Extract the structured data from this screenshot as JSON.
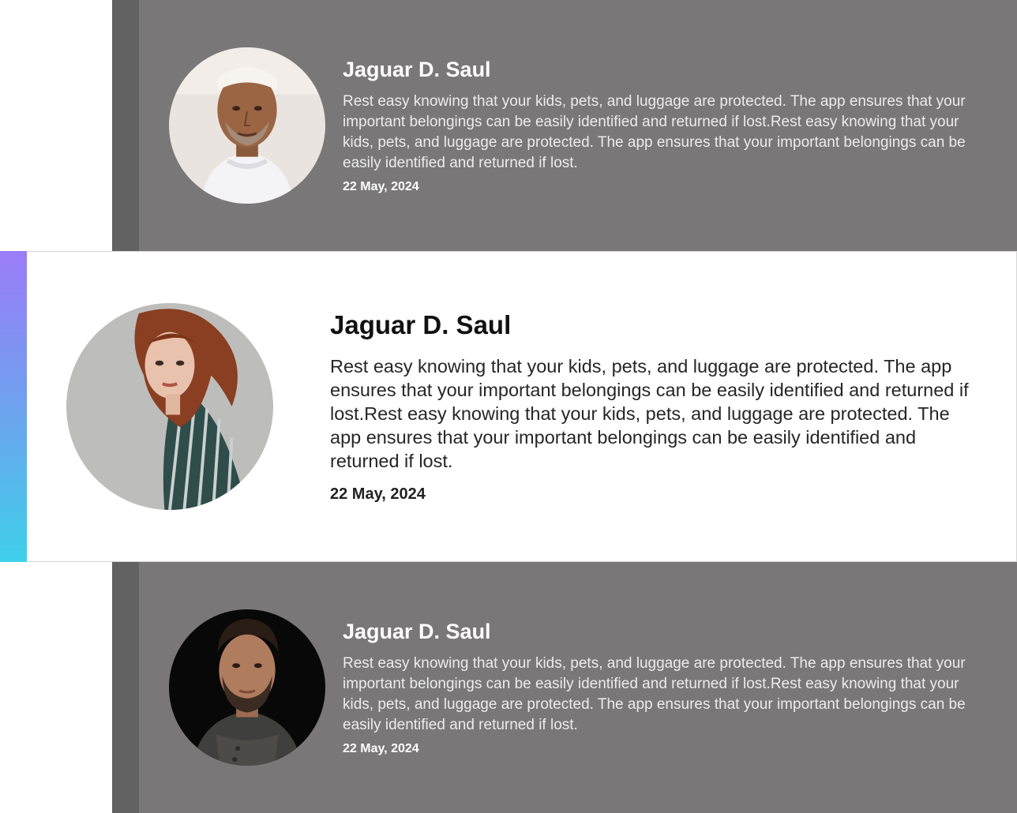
{
  "testimonials": [
    {
      "name": "Jaguar D. Saul",
      "text": "Rest easy knowing that your kids, pets, and luggage are protected. The app ensures that your important belongings can be easily identified and returned if lost.Rest easy knowing that your kids, pets, and luggage are protected. The app ensures that your important belongings can be easily identified and returned if lost.",
      "date": "22 May, 2024",
      "state": "inactive"
    },
    {
      "name": "Jaguar D. Saul",
      "text": "Rest easy knowing that your kids, pets, and luggage are protected. The app ensures that your important belongings can be easily identified and returned if lost.Rest easy knowing that your kids, pets, and luggage are protected. The app ensures that your important belongings can be easily identified and returned if lost.",
      "date": "22 May, 2024",
      "state": "active"
    },
    {
      "name": "Jaguar D. Saul",
      "text": "Rest easy knowing that your kids, pets, and luggage are protected. The app ensures that your important belongings can be easily identified and returned if lost.Rest easy knowing that your kids, pets, and luggage are protected. The app ensures that your important belongings can be easily identified and returned if lost.",
      "date": "22 May, 2024",
      "state": "inactive"
    }
  ],
  "colors": {
    "inactive_card_bg": "#797778",
    "inactive_accent": "#636262",
    "active_accent_gradient": [
      "#9b7cf7",
      "#3fd0ea"
    ],
    "active_card_bg": "#ffffff"
  }
}
